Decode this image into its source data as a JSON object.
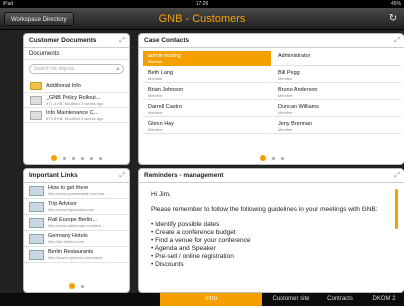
{
  "status": {
    "device": "iPad",
    "time": "17:26",
    "battery": "45%"
  },
  "nav": {
    "back_label": "Workspace Directory",
    "title": "GNB - Customers",
    "refresh_icon": "refresh-icon"
  },
  "documents": {
    "title": "Customer Documents",
    "subheader": "Documents",
    "search_placeholder": "Search for objects",
    "items": [
      {
        "name": "Additional Info",
        "meta": ""
      },
      {
        "name": "_GNB Policy Rollout...",
        "meta": "971.3 KB, Modified 3 weeks ago"
      },
      {
        "name": "Info     Maintenance C...",
        "meta": "873.8 KB, Modified 3 weeks ago"
      }
    ]
  },
  "contacts": {
    "title": "Case Contacts",
    "items": [
      {
        "name": "admin testing",
        "role": "Member"
      },
      {
        "name": "Administrator",
        "role": ""
      },
      {
        "name": "Beth Lang",
        "role": "Member"
      },
      {
        "name": "Bill Pegg",
        "role": "Member"
      },
      {
        "name": "Brian Johnson",
        "role": "Member"
      },
      {
        "name": "Bruno Anderson",
        "role": "Member"
      },
      {
        "name": "Darrell Castro",
        "role": "Member"
      },
      {
        "name": "Duncan Williams",
        "role": "Member"
      },
      {
        "name": "Glenn Hay",
        "role": "Member"
      },
      {
        "name": "Jeny Brennan",
        "role": "Member"
      }
    ]
  },
  "links": {
    "title": "Important Links",
    "items": [
      {
        "name": "How to get there",
        "url": "http://www.yourwebsite.com/ma..."
      },
      {
        "name": "Trip Advisor",
        "url": "http://www.tripadvisor.com"
      },
      {
        "name": "Rail Europe Berlin...",
        "url": "http://www.raileurope.com/eur..."
      },
      {
        "name": "Germany Hotels",
        "url": "http://de.hotels.com/"
      },
      {
        "name": "Berlin Restaurants",
        "url": "http://travel.nytimes.com/travel..."
      }
    ]
  },
  "reminders": {
    "title": "Reminders - management",
    "greeting": "Hi Jim,",
    "intro": "Please remember to follow the following guidelines in your meetings with GNB:",
    "bullets": [
      "Identify possible dates",
      "Create a conference budget",
      "Find a venue for your conference",
      "Agenda and Speaker",
      "Pre-sell / online registration",
      "Discounts"
    ]
  },
  "tabs": [
    {
      "label": "Intro",
      "active": true
    },
    {
      "label": "Customer site",
      "active": false
    },
    {
      "label": "Contracts",
      "active": false
    },
    {
      "label": "DKOM 2",
      "active": false
    }
  ],
  "colors": {
    "accent": "#f5a000",
    "nav_bg": "#2a2a2a"
  }
}
